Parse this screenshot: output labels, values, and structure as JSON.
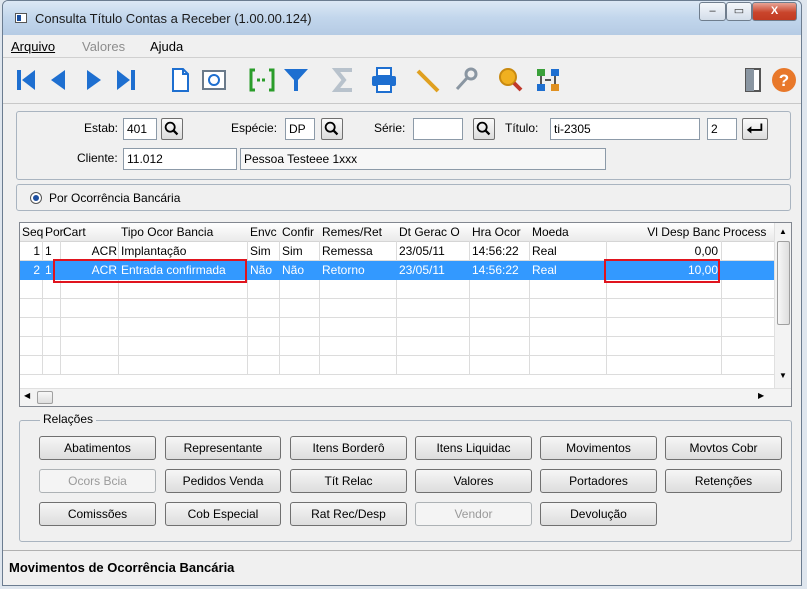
{
  "window": {
    "title": "Consulta Título Contas a Receber (1.00.00.124)",
    "controls": [
      "–",
      "▭",
      "X"
    ]
  },
  "menu": [
    "Arquivo",
    "Valores",
    "Ajuda"
  ],
  "toolbar_icons": [
    "first-record-icon",
    "previous-record-icon",
    "next-record-icon",
    "last-record-icon",
    "new-document-icon",
    "print-preview-icon",
    "goto-icon",
    "filter-icon",
    "sum-icon",
    "printer-icon",
    "pencil-icon",
    "key-icon",
    "search-icon",
    "hierarchy-icon",
    "exit-door-icon",
    "help-icon"
  ],
  "filters": {
    "estab_label": "Estab:",
    "estab_value": "401",
    "especie_label": "Espécie:",
    "especie_value": "DP",
    "serie_label": "Série:",
    "serie_value": "",
    "titulo_label": "Título:",
    "titulo_value": "ti-2305",
    "parcela_value": "2",
    "cliente_label": "Cliente:",
    "cliente_value": "11.012",
    "cliente_nome": "Pessoa Testeee 1xxx"
  },
  "option": {
    "label": "Por Ocorrência Bancária"
  },
  "grid": {
    "columns": [
      "Seq",
      "Port",
      "Cart",
      "Tipo Ocor Bancia",
      "Envc",
      "Confir",
      "Remes/Ret",
      "Dt Gerac O",
      "Hra Ocor",
      "Moeda",
      "Vl Desp Banc",
      "Process"
    ],
    "rows": [
      [
        "1",
        "1",
        "ACR",
        "Implantação",
        "Sim",
        "Sim",
        "Remessa",
        "23/05/11",
        "14:56:22",
        "Real",
        "0,00",
        ""
      ],
      [
        "2",
        "1",
        "ACR",
        "Entrada confirmada",
        "Não",
        "Não",
        "Retorno",
        "23/05/11",
        "14:56:22",
        "Real",
        "10,00",
        ""
      ]
    ],
    "selected_row": 2
  },
  "relacoes": {
    "legend": "Relações",
    "buttons": [
      [
        "Abatimentos",
        "Representante",
        "Itens Borderô",
        "Itens Liquidac",
        "Movimentos",
        "Movtos Cobr"
      ],
      [
        "Ocors Bcia",
        "Pedidos Venda",
        "Tít Relac",
        "Valores",
        "Portadores",
        "Retenções"
      ],
      [
        "Comissões",
        "Cob Especial",
        "Rat Rec/Desp",
        "Vendor",
        "Devolução"
      ]
    ],
    "disabled": [
      "Ocors Bcia",
      "Vendor"
    ]
  },
  "status_text": "Movimentos de Ocorrência Bancária",
  "colors": {
    "selection": "#3399ff",
    "highlight_box": "#e0141e"
  }
}
